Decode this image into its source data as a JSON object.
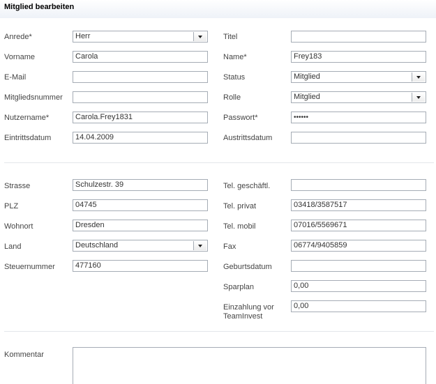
{
  "header": {
    "title": "Mitglied bearbeiten"
  },
  "left_top": {
    "anrede": {
      "label": "Anrede*",
      "value": "Herr"
    },
    "vorname": {
      "label": "Vorname",
      "value": "Carola"
    },
    "email": {
      "label": "E-Mail",
      "value": ""
    },
    "mitgliedsnummer": {
      "label": "Mitgliedsnummer",
      "value": ""
    },
    "nutzername": {
      "label": "Nutzername*",
      "value": "Carola.Frey1831"
    },
    "eintrittsdatum": {
      "label": "Eintrittsdatum",
      "value": "14.04.2009"
    }
  },
  "right_top": {
    "titel": {
      "label": "Titel",
      "value": ""
    },
    "name": {
      "label": "Name*",
      "value": "Frey183"
    },
    "status": {
      "label": "Status",
      "value": "Mitglied"
    },
    "rolle": {
      "label": "Rolle",
      "value": "Mitglied"
    },
    "passwort": {
      "label": "Passwort*",
      "value": "••••••"
    },
    "austrittsdatum": {
      "label": "Austrittsdatum",
      "value": ""
    }
  },
  "left_addr": {
    "strasse": {
      "label": "Strasse",
      "value": "Schulzestr. 39"
    },
    "plz": {
      "label": "PLZ",
      "value": "04745"
    },
    "wohnort": {
      "label": "Wohnort",
      "value": "Dresden"
    },
    "land": {
      "label": "Land",
      "value": "Deutschland"
    },
    "steuernummer": {
      "label": "Steuernummer",
      "value": "477160"
    }
  },
  "right_addr": {
    "tel_geschaeftl": {
      "label": "Tel. geschäftl.",
      "value": ""
    },
    "tel_privat": {
      "label": "Tel. privat",
      "value": "03418/3587517"
    },
    "tel_mobil": {
      "label": "Tel. mobil",
      "value": "07016/5569671"
    },
    "fax": {
      "label": "Fax",
      "value": "06774/9405859"
    },
    "geburtsdatum": {
      "label": "Geburtsdatum",
      "value": ""
    },
    "sparplan": {
      "label": "Sparplan",
      "value": "0,00"
    },
    "einzahlung": {
      "label_line1": "Einzahlung vor",
      "label_line2": "TeamInvest",
      "value": "0,00"
    }
  },
  "comment": {
    "label": "Kommentar",
    "value": ""
  },
  "icons": {
    "dropdown": "chevron-down-icon"
  }
}
